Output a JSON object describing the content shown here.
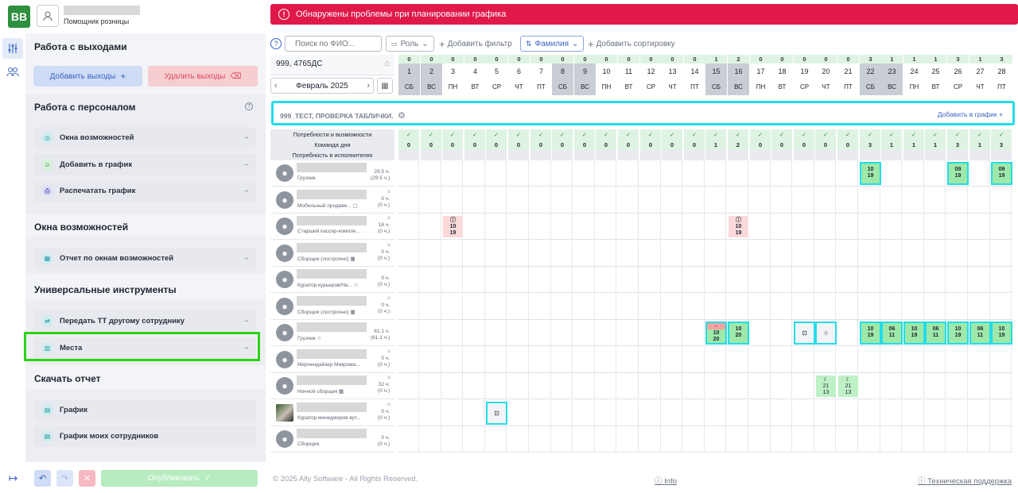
{
  "app": {
    "logo": "BB",
    "user_role": "Помощник розницы",
    "alert": "Обнаружены проблемы при планировании графика"
  },
  "sidebar": {
    "section_exits": {
      "title": "Работа с выходами",
      "add_label": "Добавить выходы",
      "delete_label": "Удалить выходы"
    },
    "section_staff": {
      "title": "Работа с персоналом",
      "items": [
        {
          "label": "Окна возможностей"
        },
        {
          "label": "Добавить в график"
        },
        {
          "label": "Распечатать график"
        }
      ]
    },
    "section_windows": {
      "title": "Окна возможностей",
      "items": [
        {
          "label": "Отчет по окнам возможностей"
        }
      ]
    },
    "section_tools": {
      "title": "Универсальные инструменты",
      "items": [
        {
          "label": "Передать ТТ другому сотруднику"
        },
        {
          "label": "Места"
        }
      ]
    },
    "section_report": {
      "title": "Скачать отчет",
      "items": [
        {
          "label": "График"
        },
        {
          "label": "График моих сотрудников"
        }
      ]
    }
  },
  "bottom": {
    "publish_label": "Опубликовать",
    "copyright": "© 2025 Ally Software - All Rights Reserved.",
    "info": "Info",
    "support": "Техническая поддержка"
  },
  "toolbar": {
    "search_placeholder": "Поиск по ФИО...",
    "role_label": "Роль",
    "add_filter": "Добавить фильтр",
    "sort_label": "Фамилия",
    "add_sort": "Добавить сортировку"
  },
  "schedule": {
    "location": "999, 4765ДС",
    "month": "Февраль 2025",
    "group_title": "999_ТЕСТ, ПРОВЕРКА ТАБЛИЧКИ.",
    "group_add": "Добавить в график",
    "needs_labels": [
      "Потребности и возможности",
      "Команда дня",
      "Потребность в исполнителях"
    ],
    "days": [
      {
        "n": "1",
        "wd": "СБ",
        "c": "0",
        "we": true
      },
      {
        "n": "2",
        "wd": "ВС",
        "c": "0",
        "we": true
      },
      {
        "n": "3",
        "wd": "ПН",
        "c": "0"
      },
      {
        "n": "4",
        "wd": "ВТ",
        "c": "0"
      },
      {
        "n": "5",
        "wd": "СР",
        "c": "0"
      },
      {
        "n": "6",
        "wd": "ЧТ",
        "c": "0"
      },
      {
        "n": "7",
        "wd": "ПТ",
        "c": "0"
      },
      {
        "n": "8",
        "wd": "СБ",
        "c": "0",
        "we": true
      },
      {
        "n": "9",
        "wd": "ВС",
        "c": "0",
        "we": true
      },
      {
        "n": "10",
        "wd": "ПН",
        "c": "0"
      },
      {
        "n": "11",
        "wd": "ВТ",
        "c": "0"
      },
      {
        "n": "12",
        "wd": "СР",
        "c": "0"
      },
      {
        "n": "13",
        "wd": "ЧТ",
        "c": "0"
      },
      {
        "n": "14",
        "wd": "ПТ",
        "c": "0"
      },
      {
        "n": "15",
        "wd": "СБ",
        "c": "1",
        "we": true
      },
      {
        "n": "16",
        "wd": "ВС",
        "c": "2",
        "we": true
      },
      {
        "n": "17",
        "wd": "ПН",
        "c": "0"
      },
      {
        "n": "18",
        "wd": "ВТ",
        "c": "0"
      },
      {
        "n": "19",
        "wd": "СР",
        "c": "0"
      },
      {
        "n": "20",
        "wd": "ЧТ",
        "c": "0"
      },
      {
        "n": "21",
        "wd": "ПТ",
        "c": "0"
      },
      {
        "n": "22",
        "wd": "СБ",
        "c": "3",
        "we": true
      },
      {
        "n": "23",
        "wd": "ВС",
        "c": "1",
        "we": true
      },
      {
        "n": "24",
        "wd": "ПН",
        "c": "1"
      },
      {
        "n": "25",
        "wd": "ВТ",
        "c": "1"
      },
      {
        "n": "26",
        "wd": "СР",
        "c": "3"
      },
      {
        "n": "27",
        "wd": "ЧТ",
        "c": "1"
      },
      {
        "n": "28",
        "wd": "ПТ",
        "c": "3"
      }
    ],
    "employees": [
      {
        "role": "Грузчик",
        "hours": "29.5 ч.",
        "hours2": "(29.5 ч.)"
      },
      {
        "role": "Мобильный продаве...",
        "hours": "0 ч.",
        "hours2": "(0 ч.)"
      },
      {
        "role": "Старший кассир-компле...",
        "hours": "18 ч.",
        "hours2": "(0 ч.)"
      },
      {
        "role": "Сборщик (построчно)",
        "hours": "0 ч.",
        "hours2": "(0 ч.)"
      },
      {
        "role": "Куратор курьеров/На...",
        "hours": "0 ч.",
        "hours2": "(0 ч.)"
      },
      {
        "role": "Сборщик (построчно)",
        "hours": "0 ч.",
        "hours2": "(0 ч.)"
      },
      {
        "role": "Грузчик",
        "hours": "61.1 ч.",
        "hours2": "(61.1 ч.)"
      },
      {
        "role": "Мерчендайзер Микрома...",
        "hours": "0 ч.",
        "hours2": "(0 ч.)"
      },
      {
        "role": "Ночной сборщик",
        "hours": "32 ч.",
        "hours2": "(0 ч.)"
      },
      {
        "role": "Куратор менеджеров вут...",
        "hours": "0 ч.",
        "hours2": "(0 ч.)"
      },
      {
        "role": "Сборщик",
        "hours": "0 ч.",
        "hours2": "(0 ч.)"
      }
    ],
    "shifts": [
      {
        "row": 0,
        "day": 22,
        "a": "10",
        "b": "19",
        "kind": "green",
        "sel": true
      },
      {
        "row": 0,
        "day": 26,
        "a": "09",
        "b": "19",
        "kind": "green",
        "sel": true
      },
      {
        "row": 0,
        "day": 28,
        "a": "09",
        "b": "19",
        "kind": "green",
        "sel": true
      },
      {
        "row": 2,
        "day": 3,
        "a": "10",
        "b": "19",
        "kind": "pink",
        "icon": "warn-icon"
      },
      {
        "row": 2,
        "day": 16,
        "a": "10",
        "b": "19",
        "kind": "pink",
        "icon": "warn-icon"
      },
      {
        "row": 6,
        "day": 15,
        "a": "10",
        "b": "20",
        "kind": "redtop",
        "sel": true
      },
      {
        "row": 6,
        "day": 16,
        "a": "10",
        "b": "20",
        "kind": "green",
        "sel": true
      },
      {
        "row": 6,
        "day": 19,
        "a": "",
        "b": "",
        "kind": "icon",
        "sel": true,
        "glyph": "⊡"
      },
      {
        "row": 6,
        "day": 20,
        "a": "",
        "b": "",
        "kind": "icon",
        "sel": true,
        "glyph": "☆"
      },
      {
        "row": 6,
        "day": 22,
        "a": "10",
        "b": "19",
        "kind": "green",
        "sel": true
      },
      {
        "row": 6,
        "day": 23,
        "a": "06",
        "b": "11",
        "kind": "green",
        "sel": true
      },
      {
        "row": 6,
        "day": 24,
        "a": "10",
        "b": "19",
        "kind": "green",
        "sel": true
      },
      {
        "row": 6,
        "day": 25,
        "a": "06",
        "b": "11",
        "kind": "green",
        "sel": true
      },
      {
        "row": 6,
        "day": 26,
        "a": "10",
        "b": "19",
        "kind": "green",
        "sel": true
      },
      {
        "row": 6,
        "day": 27,
        "a": "06",
        "b": "11",
        "kind": "green",
        "sel": true
      },
      {
        "row": 6,
        "day": 28,
        "a": "10",
        "b": "19",
        "kind": "green",
        "sel": true
      },
      {
        "row": 8,
        "day": 20,
        "a": "21",
        "b": "13",
        "kind": "lightgreen",
        "icon": "moon-icon"
      },
      {
        "row": 8,
        "day": 21,
        "a": "21",
        "b": "13",
        "kind": "lightgreen",
        "icon": "moon-icon"
      },
      {
        "row": 9,
        "day": 5,
        "a": "",
        "b": "",
        "kind": "icon",
        "sel": true,
        "glyph": "⊡"
      }
    ]
  },
  "colors": {
    "brand": "#2e8f3f",
    "alert": "#e0194a",
    "accent": "#3b63c4",
    "highlight": "#2bd215",
    "select": "#23dce9"
  }
}
